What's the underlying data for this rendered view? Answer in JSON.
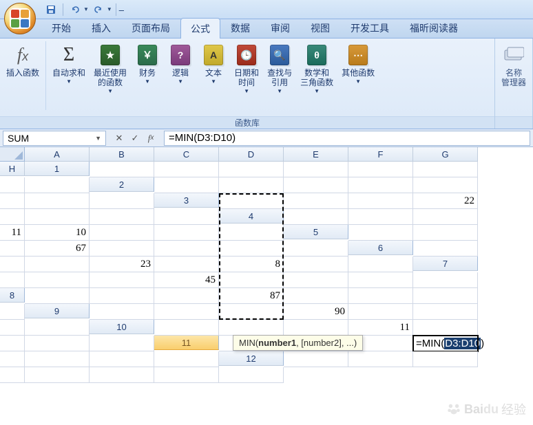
{
  "qat": {
    "save": "保存",
    "undo": "撤销",
    "redo": "恢复"
  },
  "tabs": {
    "home": "开始",
    "insert": "插入",
    "layout": "页面布局",
    "formulas": "公式",
    "data": "数据",
    "review": "审阅",
    "view": "视图",
    "dev": "开发工具",
    "foxit": "福昕阅读器"
  },
  "ribbon": {
    "insert_fn": "插入函数",
    "autosum": "自动求和",
    "recent": "最近使用\n的函数",
    "financial": "财务",
    "logical": "逻辑",
    "text": "文本",
    "datetime": "日期和\n时间",
    "lookup": "查找与\n引用",
    "math": "数学和\n三角函数",
    "more": "其他函数",
    "name_mgr": "名称\n管理器",
    "group_label": "函数库"
  },
  "namebox": "SUM",
  "formula": "=MIN(D3:D10)",
  "columns": [
    "A",
    "B",
    "C",
    "D",
    "E",
    "F",
    "G",
    "H"
  ],
  "rows": [
    "1",
    "2",
    "3",
    "4",
    "5",
    "6",
    "7",
    "8",
    "9",
    "10",
    "11",
    "12"
  ],
  "cells": {
    "D3": "22",
    "D4": "11",
    "D5": "67",
    "D6": "23",
    "D7": "45",
    "D8": "87",
    "D9": "90",
    "D10": "11",
    "E4": "10",
    "F6": "8"
  },
  "editing_cell": {
    "prefix": "=MIN(",
    "ref": "D3:D10",
    "suffix": ")"
  },
  "tooltip": {
    "fn": "MIN(",
    "arg1": "number1",
    "rest": ", [number2], ...)"
  },
  "watermark": "经验"
}
